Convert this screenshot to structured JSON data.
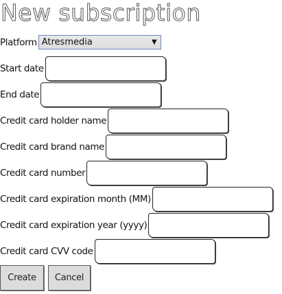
{
  "page": {
    "title": "New subscription"
  },
  "form": {
    "platform": {
      "label": "Platform",
      "selected": "Atresmedia"
    },
    "start_date": {
      "label": "Start date",
      "value": ""
    },
    "end_date": {
      "label": "End date",
      "value": ""
    },
    "holder_name": {
      "label": "Credit card holder name",
      "value": ""
    },
    "brand_name": {
      "label": "Credit card brand name",
      "value": ""
    },
    "card_number": {
      "label": "Credit card number",
      "value": ""
    },
    "exp_month": {
      "label": "Credit card expiration month (MM)",
      "value": ""
    },
    "exp_year": {
      "label": "Credit card expiration year (yyyy)",
      "value": ""
    },
    "cvv": {
      "label": "Credit card CVV code",
      "value": ""
    }
  },
  "buttons": {
    "create": "Create",
    "cancel": "Cancel"
  },
  "icons": {
    "select_arrow": "chevron-down-icon"
  }
}
